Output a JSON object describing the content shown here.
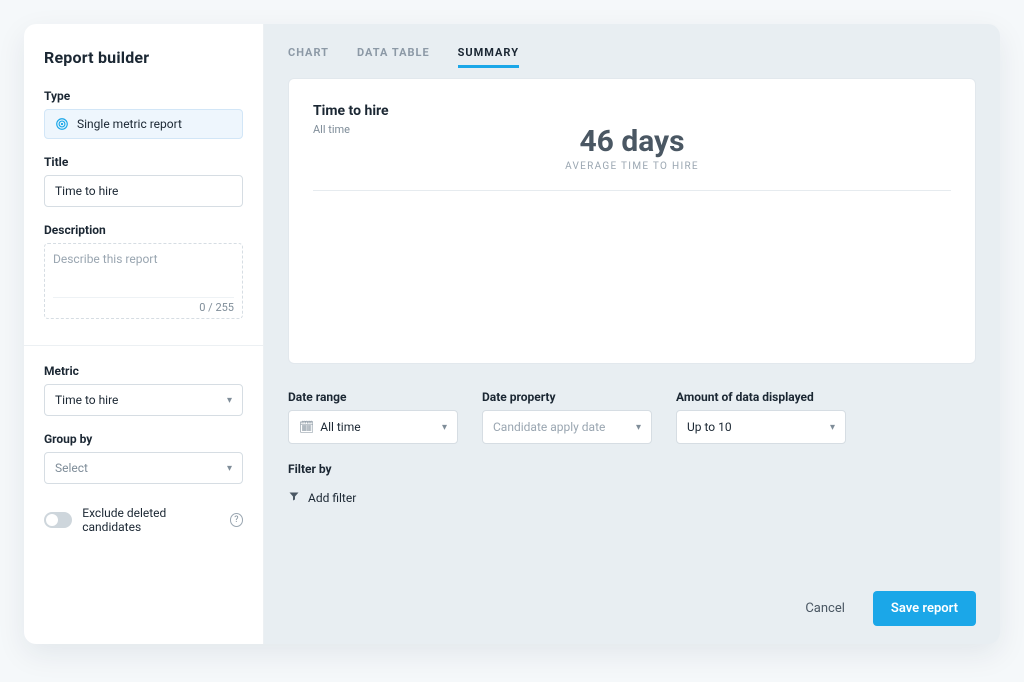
{
  "sidebar": {
    "title": "Report builder",
    "type": {
      "label": "Type",
      "value": "Single metric report"
    },
    "title_field": {
      "label": "Title",
      "value": "Time to hire"
    },
    "description": {
      "label": "Description",
      "placeholder": "Describe this report",
      "counter": "0 / 255"
    },
    "metric": {
      "label": "Metric",
      "value": "Time to hire"
    },
    "group_by": {
      "label": "Group by",
      "placeholder": "Select"
    },
    "exclude_deleted": {
      "label": "Exclude deleted candidates"
    }
  },
  "tabs": {
    "chart": "CHART",
    "data_table": "DATA TABLE",
    "summary": "SUMMARY",
    "active": "summary"
  },
  "card": {
    "title": "Time to hire",
    "subtitle": "All time",
    "metric_value": "46 days",
    "metric_label": "AVERAGE TIME TO HIRE"
  },
  "controls": {
    "date_range": {
      "label": "Date range",
      "value": "All time"
    },
    "date_property": {
      "label": "Date property",
      "value": "Candidate apply date"
    },
    "amount": {
      "label": "Amount of data displayed",
      "value": "Up to 10"
    },
    "filter_by": {
      "label": "Filter by",
      "add": "Add filter"
    }
  },
  "footer": {
    "cancel": "Cancel",
    "save": "Save report"
  }
}
